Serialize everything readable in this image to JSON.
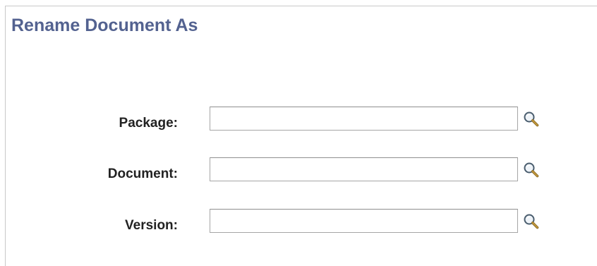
{
  "page": {
    "title": "Rename Document As"
  },
  "fields": {
    "package": {
      "label": "Package:",
      "value": "",
      "placeholder": ""
    },
    "document": {
      "label": "Document:",
      "value": "",
      "placeholder": ""
    },
    "version": {
      "label": "Version:",
      "value": "",
      "placeholder": ""
    }
  },
  "icons": {
    "lookup": "magnifying-glass-lookup-icon"
  },
  "colors": {
    "title": "#536290",
    "label": "#222222",
    "input_border": "#a6a6a6"
  }
}
